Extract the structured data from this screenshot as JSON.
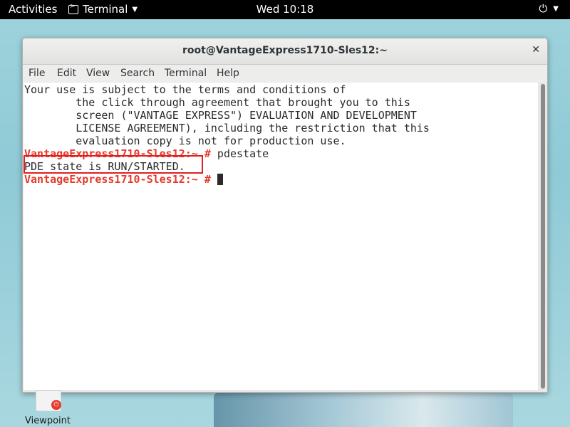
{
  "topbar": {
    "activities": "Activities",
    "app_name": "Terminal",
    "clock": "Wed 10:18"
  },
  "window": {
    "title": "root@VantageExpress1710-Sles12:~",
    "close_glyph": "✕",
    "menu": [
      "File",
      "Edit",
      "View",
      "Search",
      "Terminal",
      "Help"
    ]
  },
  "terminal": {
    "lines": [
      "Your use is subject to the terms and conditions of",
      "        the click through agreement that brought you to this",
      "        screen (\"VANTAGE EXPRESS\") EVALUATION AND DEVELOPMENT",
      "        LICENSE AGREEMENT), including the restriction that this",
      "        evaluation copy is not for production use."
    ],
    "prompt": "VantageExpress1710-Sles12:~ #",
    "command": " pdestate",
    "output": "PDE state is RUN/STARTED.",
    "prompt2": "VantageExpress1710-Sles12:~ #"
  },
  "desktop": {
    "icon_label": "Viewpoint"
  },
  "colors": {
    "prompt": "#e53a2c",
    "highlight_box": "#e02020"
  }
}
